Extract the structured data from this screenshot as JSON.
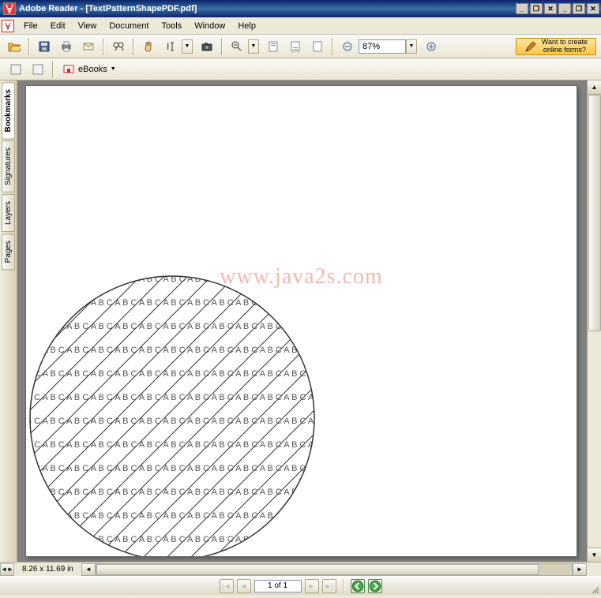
{
  "title": "Adobe Reader - [TextPatternShapePDF.pdf]",
  "menu": {
    "items": [
      "File",
      "Edit",
      "View",
      "Document",
      "Tools",
      "Window",
      "Help"
    ]
  },
  "toolbar": {
    "zoom_value": "87%",
    "forms_label_line1": "Want to create",
    "forms_label_line2": "online forms?"
  },
  "toolbar2": {
    "ebooks_label": "eBooks"
  },
  "sidebar": {
    "tabs": [
      "Bookmarks",
      "Signatures",
      "Layers",
      "Pages"
    ],
    "active": 0
  },
  "document": {
    "watermark": "www.java2s.com",
    "pattern_text": "A B C",
    "page_size": "8.26 x 11.69 in"
  },
  "navbar": {
    "page_indicator": "1 of 1"
  }
}
